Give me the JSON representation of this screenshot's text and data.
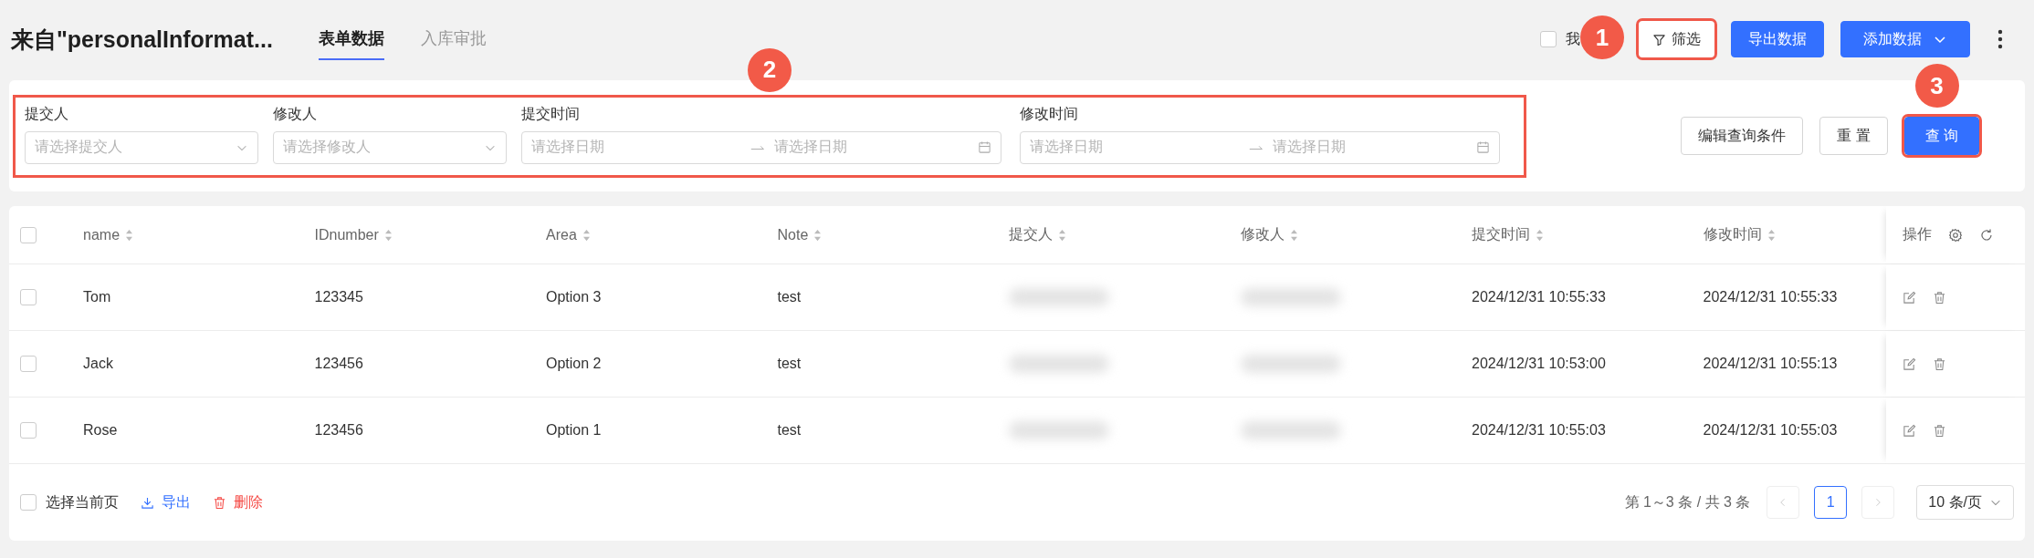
{
  "header": {
    "title": "来自\"personalInformat...",
    "tabs": [
      {
        "label": "表单数据",
        "selected": true
      },
      {
        "label": "入库审批",
        "selected": false
      }
    ],
    "mine_checkbox": {
      "label": "我",
      "checked": false
    },
    "buttons": [
      {
        "label": "筛选",
        "kind": "filter",
        "highlighted": true,
        "annotation": "1"
      },
      {
        "label": "导出数据",
        "kind": "primary",
        "highlighted": false
      },
      {
        "label": "添加数据",
        "kind": "dropdown",
        "highlighted": false
      }
    ]
  },
  "filters": {
    "highlighted": true,
    "annotation": "2",
    "fields": [
      {
        "label": "提交人",
        "kind": "select",
        "placeholder": "请选择提交人"
      },
      {
        "label": "修改人",
        "kind": "select",
        "placeholder": "请选择修改人"
      },
      {
        "label": "提交时间",
        "kind": "range",
        "placeholder": "请选择日期",
        "placeholder_end": "请选择日期"
      },
      {
        "label": "修改时间",
        "kind": "range",
        "placeholder": "请选择日期",
        "placeholder_end": "请选择日期"
      }
    ],
    "buttons": [
      {
        "label": "编辑查询条件",
        "kind": "default",
        "highlighted": false
      },
      {
        "label": "重 置",
        "kind": "default",
        "highlighted": false
      },
      {
        "label": "查 询",
        "kind": "primary",
        "highlighted": true,
        "annotation": "3"
      }
    ]
  },
  "table": {
    "header_checkbox": {
      "checked": false
    },
    "columns": [
      "name",
      "IDnumber",
      "Area",
      "Note",
      "提交人",
      "修改人",
      "提交时间",
      "修改时间"
    ],
    "actions_column": "操作",
    "rows": [
      {
        "selected": false,
        "cells": [
          "Tom",
          "123345",
          "Option 3",
          "test",
          null,
          null,
          "2024/12/31 10:55:33",
          "2024/12/31 10:55:33"
        ]
      },
      {
        "selected": false,
        "cells": [
          "Jack",
          "123456",
          "Option 2",
          "test",
          null,
          null,
          "2024/12/31 10:53:00",
          "2024/12/31 10:55:13"
        ]
      },
      {
        "selected": false,
        "cells": [
          "Rose",
          "123456",
          "Option 1",
          "test",
          null,
          null,
          "2024/12/31 10:55:03",
          "2024/12/31 10:55:03"
        ]
      }
    ]
  },
  "footer": {
    "select_page": {
      "label": "选择当前页",
      "checked": false
    },
    "actions": [
      {
        "label": "导出",
        "kind": "export"
      },
      {
        "label": "删除",
        "kind": "delete"
      }
    ],
    "range": "第 1～3 条 / 共 3 条",
    "prev_disabled": true,
    "next_disabled": true,
    "pages": [
      {
        "label": "1",
        "selected": true
      }
    ],
    "page_size": "10 条/页"
  }
}
